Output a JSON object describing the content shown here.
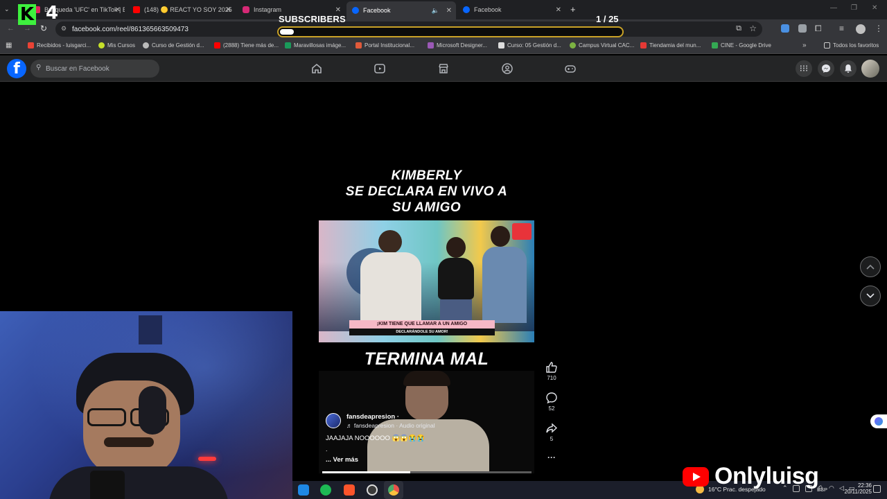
{
  "browser": {
    "tabs": [
      {
        "label": "Búsqueda 'UFC' en TikTok | Bus",
        "color": "#e0245e"
      },
      {
        "label": "(148) 🟡 REACT YO SOY 2025",
        "color": "#ff0000"
      },
      {
        "label": "Instagram",
        "color": "#d62976"
      },
      {
        "label": "Facebook",
        "color": "#0866ff"
      },
      {
        "label": "Facebook",
        "color": "#0866ff"
      }
    ],
    "new_tab_label": "+",
    "url": "facebook.com/reel/861365663509473",
    "bookmarks": [
      {
        "label": "Recibidos - luisgarci...",
        "color": "#ea4335"
      },
      {
        "label": "Mis Cursos",
        "color": "#c6e02a"
      },
      {
        "label": "Curso de Gestión d...",
        "color": "#bbbbbb"
      },
      {
        "label": "(2888) Tiene más de...",
        "color": "#ff0000"
      },
      {
        "label": "Maravillosas imáge...",
        "color": "#1a9a5a"
      },
      {
        "label": "Portal Institucional...",
        "color": "#e05a3a"
      },
      {
        "label": "Microsoft Designer...",
        "color": "#9b59b6"
      },
      {
        "label": "Curso: 05 Gestión d...",
        "color": "#dddddd"
      },
      {
        "label": "Campus Virtual CAC...",
        "color": "#7cb342"
      },
      {
        "label": "Tiendamia del mun...",
        "color": "#e53935"
      },
      {
        "label": "CINE - Google Drive",
        "color": "#34a853"
      }
    ],
    "all_bookmarks_label": "Todos los favoritos"
  },
  "overlay": {
    "k_badge": "K",
    "k_number": "4",
    "subscribers_label": "SUBSCRIBERS",
    "subscribers_count": "1  / 25",
    "subscribers_progress": 0.04,
    "watermark": "Onlyluisg"
  },
  "facebook": {
    "logo": "f",
    "search_placeholder": "Buscar en Facebook",
    "nav_icons": [
      "home-icon",
      "video-icon",
      "marketplace-icon",
      "groups-icon",
      "gaming-icon"
    ],
    "right_icons": [
      "menu-grid-icon",
      "messenger-icon",
      "notifications-icon",
      "profile-avatar"
    ]
  },
  "reel": {
    "headline_lines": [
      "KIMBERLY",
      "SE DECLARA EN VIVO A",
      "SU AMIGO"
    ],
    "lower_banner": "¡KIM TIENE QUE LLAMAR A UN AMIGO",
    "lower_banner_sub": "DECLARÁNDOLE SU AMOR!",
    "ending_text": "TERMINA MAL",
    "author": "fansdeapresion",
    "author_suffix": "·",
    "audio": "♬ fansdeapresion · Audio original",
    "caption": "JAAJAJA NOOOOOO 😱😱😭😭",
    "caption_dot": ".",
    "see_more": "... Ver más",
    "progress": 0.42,
    "likes": "710",
    "comments": "52",
    "shares": "5",
    "more": "···"
  },
  "taskbar": {
    "weather": "16°C  Prac. despejado",
    "lang": "ESP",
    "time": "22:36",
    "date": "20/11/2025",
    "apps": [
      {
        "name": "edge-icon",
        "color": "#1e88e5"
      },
      {
        "name": "spotify-icon",
        "color": "#1db954"
      },
      {
        "name": "brave-icon",
        "color": "#fb542b"
      },
      {
        "name": "obs-icon",
        "color": "#3a3a3a"
      },
      {
        "name": "chrome-icon",
        "color": "#e8453c"
      }
    ]
  }
}
